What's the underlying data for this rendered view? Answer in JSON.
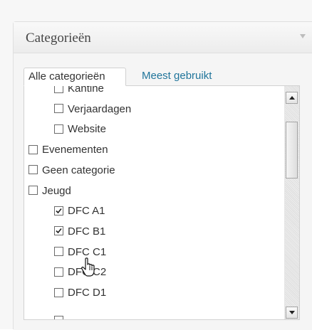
{
  "panel": {
    "title": "Categorieën"
  },
  "tabs": {
    "all_label": "Alle categorieën",
    "popular_label": "Meest gebruikt"
  },
  "categories": [
    {
      "label": "Kantine",
      "checked": false,
      "level": 1
    },
    {
      "label": "Verjaardagen",
      "checked": false,
      "level": 1
    },
    {
      "label": "Website",
      "checked": false,
      "level": 1
    },
    {
      "label": "Evenementen",
      "checked": false,
      "level": 0
    },
    {
      "label": "Geen categorie",
      "checked": false,
      "level": 0
    },
    {
      "label": "Jeugd",
      "checked": false,
      "level": 0
    },
    {
      "label": "DFC A1",
      "checked": true,
      "level": 1
    },
    {
      "label": "DFC B1",
      "checked": true,
      "level": 1
    },
    {
      "label": "DFC C1",
      "checked": false,
      "level": 1
    },
    {
      "label": "DFC C2",
      "checked": false,
      "level": 1
    },
    {
      "label": "DFC D1",
      "checked": false,
      "level": 1
    }
  ],
  "colors": {
    "link": "#21759b",
    "border": "#d1d1d1"
  }
}
